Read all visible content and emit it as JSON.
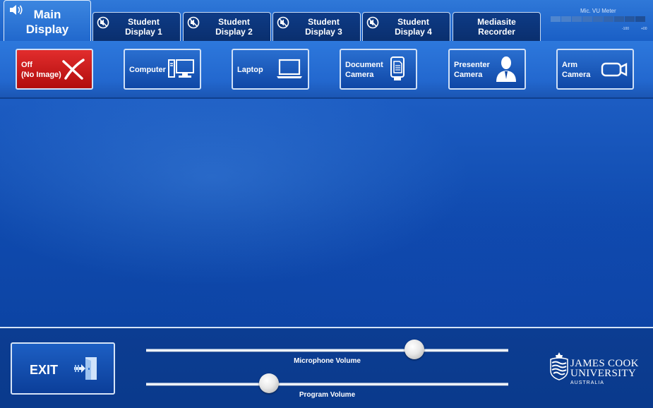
{
  "tabs": [
    {
      "label": "Main\nDisplay",
      "active": true,
      "icon": "speaker-icon"
    },
    {
      "label": "Student\nDisplay 1",
      "active": false,
      "icon": "muted-icon"
    },
    {
      "label": "Student\nDisplay 2",
      "active": false,
      "icon": "muted-icon"
    },
    {
      "label": "Student\nDisplay 3",
      "active": false,
      "icon": "muted-icon"
    },
    {
      "label": "Student\nDisplay 4",
      "active": false,
      "icon": "muted-icon"
    },
    {
      "label": "Mediasite\nRecorder",
      "active": false,
      "icon": ""
    }
  ],
  "vu_meter": {
    "title": "Mic. VU Meter",
    "min_label": "-100",
    "max_label": "+00"
  },
  "sources": [
    {
      "label": "Off\n(No Image)",
      "icon": "x-icon",
      "selected": true
    },
    {
      "label": "Computer",
      "icon": "desktop-computer-icon"
    },
    {
      "label": "Laptop",
      "icon": "laptop-icon"
    },
    {
      "label": "Document\nCamera",
      "icon": "document-camera-icon"
    },
    {
      "label": "Presenter\nCamera",
      "icon": "presenter-icon"
    },
    {
      "label": "Arm\nCamera",
      "icon": "video-camera-icon"
    }
  ],
  "exit": {
    "label": "EXIT",
    "icon": "exit-door-icon"
  },
  "sliders": {
    "microphone": {
      "label": "Microphone Volume",
      "value_pct": 74
    },
    "program": {
      "label": "Program Volume",
      "value_pct": 34
    }
  },
  "logo": {
    "line1": "JAMES COOK",
    "line2": "UNIVERSITY",
    "line3": "AUSTRALIA"
  },
  "colors": {
    "accent": "#1c5cc2",
    "off_button": "#c81a1a",
    "border": "#cfe0f7"
  }
}
